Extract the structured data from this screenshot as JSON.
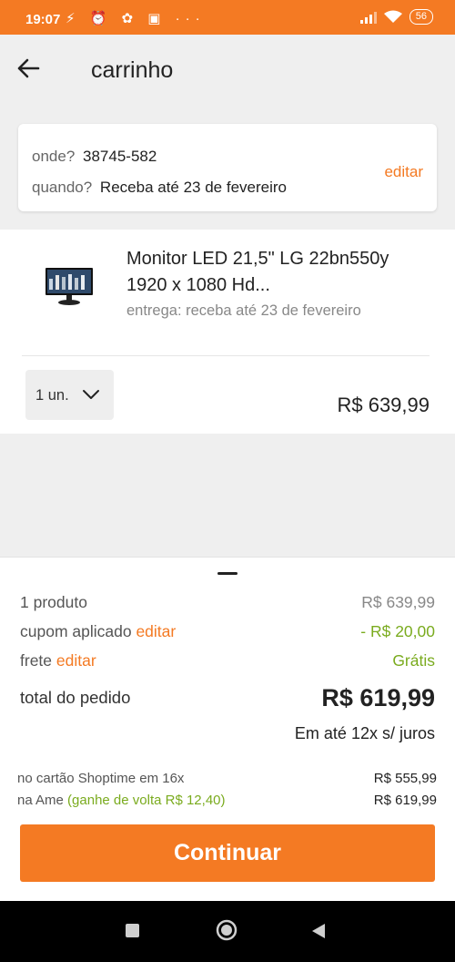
{
  "status_bar": {
    "time": "19:07",
    "notification_icons": "⚡ ⏰ ✿ ▣  ···",
    "signal": "📶",
    "battery": "56"
  },
  "header": {
    "title": "carrinho"
  },
  "address": {
    "where_label": "onde?",
    "where_value": "38745-582",
    "when_label": "quando?",
    "when_value": "Receba até 23 de fevereiro",
    "edit_label": "editar"
  },
  "product": {
    "name": "Monitor LED  21,5\" LG 22bn550y 1920 x 1080 Hd...",
    "delivery": "entrega: receba até 23 de fevereiro",
    "quantity": "1 un.",
    "price": "R$ 639,99"
  },
  "summary": {
    "products_label": "1 produto",
    "products_value": "R$ 639,99",
    "coupon_label": "cupom aplicado",
    "coupon_edit": "editar",
    "coupon_value": "- R$ 20,00",
    "shipping_label": "frete",
    "shipping_edit": "editar",
    "shipping_value": "Grátis",
    "total_label": "total do pedido",
    "total_value": "R$ 619,99",
    "installments": "Em até 12x s/ juros",
    "card_label": "no cartão Shoptime em 16x",
    "card_value": "R$ 555,99",
    "ame_label": "na Ame",
    "ame_cashback": "(ganhe de volta R$ 12,40)",
    "ame_value": "R$ 619,99",
    "continue_label": "Continuar"
  },
  "colors": {
    "accent": "#f47a23",
    "success": "#7aab1e"
  },
  "icons": {
    "back": "arrow-left-icon",
    "chevron": "chevron-down-icon",
    "recents": "square-icon",
    "home": "circle-icon",
    "nav_back": "triangle-back-icon"
  }
}
